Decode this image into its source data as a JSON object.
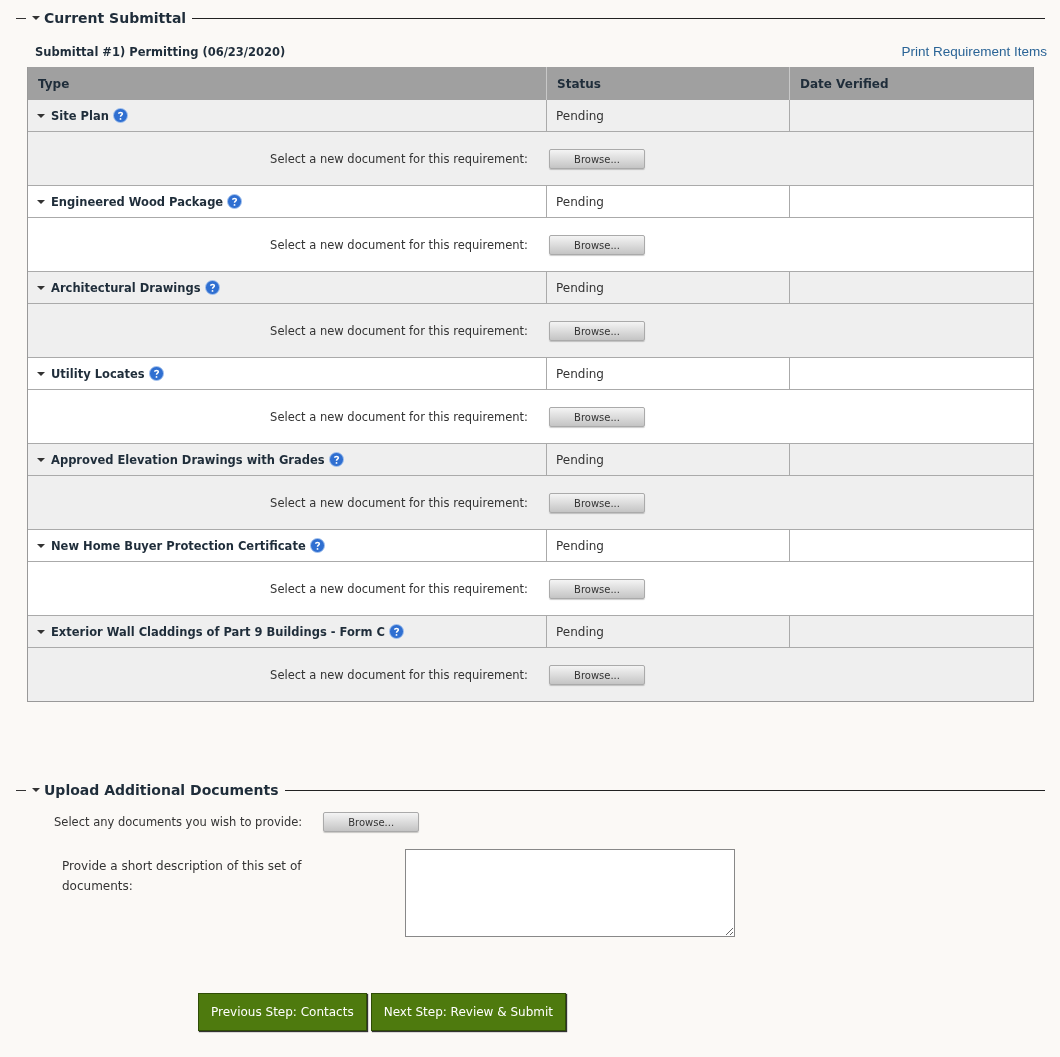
{
  "current_submittal": {
    "title": "Current Submittal",
    "expanded": true,
    "subtitle": "Submittal #1) Permitting (06/23/2020)",
    "print_link": "Print Requirement Items",
    "table": {
      "columns": [
        "Type",
        "Status",
        "Date Verified"
      ],
      "rows": [
        {
          "type": "Site Plan",
          "expanded": true,
          "status": "Pending",
          "upload_label": "Select a new document for this requirement:",
          "browse": "Browse..."
        },
        {
          "type": "Engineered Wood Package",
          "expanded": true,
          "status": "Pending",
          "upload_label": "Select a new document for this requirement:",
          "browse": "Browse..."
        },
        {
          "type": "Architectural Drawings",
          "expanded": true,
          "status": "Pending",
          "upload_label": "Select a new document for this requirement:",
          "browse": "Browse..."
        },
        {
          "type": "Utility Locates",
          "expanded": true,
          "status": "Pending",
          "upload_label": "Select a new document for this requirement:",
          "browse": "Browse..."
        },
        {
          "type": "Approved Elevation Drawings with Grades",
          "expanded": true,
          "status": "Pending",
          "upload_label": "Select a new document for this requirement:",
          "browse": "Browse..."
        },
        {
          "type": "New Home Buyer Protection Certificate",
          "expanded": true,
          "status": "Pending",
          "upload_label": "Select a new document for this requirement:",
          "browse": "Browse..."
        },
        {
          "type": "Exterior Wall Claddings of Part 9 Buildings - Form C",
          "expanded": true,
          "status": "Pending",
          "upload_label": "Select a new document for this requirement:",
          "browse": "Browse..."
        }
      ]
    }
  },
  "upload_additional": {
    "title": "Upload Additional Documents",
    "expanded": true,
    "select_label": "Select any documents you wish to provide:",
    "browse": "Browse...",
    "description_label": "Provide a short description of this set of documents:"
  },
  "buttons": [
    "Previous Step: Contacts",
    "Next Step: Review & Submit"
  ]
}
